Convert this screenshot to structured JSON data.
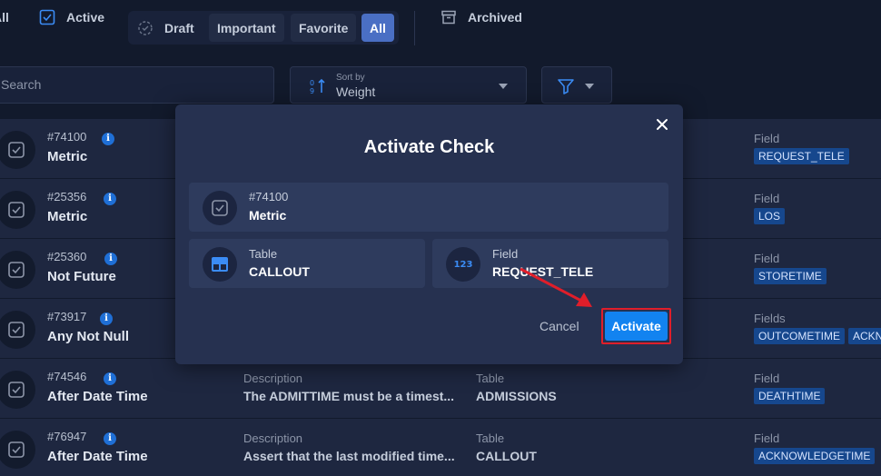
{
  "filters": {
    "all_partial": "All",
    "active": "Active",
    "draft": "Draft",
    "important": "Important",
    "favorite": "Favorite",
    "all": "All",
    "archived": "Archived"
  },
  "search": {
    "placeholder": "Search"
  },
  "sort": {
    "label": "Sort by",
    "value": "Weight"
  },
  "rows": [
    {
      "id": "#74100",
      "name": "Metric",
      "field_label": "Field",
      "tags": [
        "REQUEST_TELE"
      ]
    },
    {
      "id": "#25356",
      "name": "Metric",
      "field_label": "Field",
      "tags": [
        "LOS"
      ]
    },
    {
      "id": "#25360",
      "name": "Not Future",
      "field_label": "Field",
      "tags": [
        "STORETIME"
      ]
    },
    {
      "id": "#73917",
      "name": "Any Not Null",
      "field_label": "Fields",
      "tags": [
        "OUTCOMETIME",
        "ACKN"
      ]
    },
    {
      "id": "#74546",
      "name": "After Date Time",
      "desc_label": "Description",
      "desc": "The ADMITTIME must be a timest...",
      "table_label": "Table",
      "table": "ADMISSIONS",
      "field_label": "Field",
      "tags": [
        "DEATHTIME"
      ]
    },
    {
      "id": "#76947",
      "name": "After Date Time",
      "desc_label": "Description",
      "desc": "Assert that the last modified time...",
      "table_label": "Table",
      "table": "CALLOUT",
      "field_label": "Field",
      "tags": [
        "ACKNOWLEDGETIME"
      ]
    }
  ],
  "modal": {
    "title": "Activate Check",
    "check_id": "#74100",
    "check_name": "Metric",
    "table_label": "Table",
    "table_value": "CALLOUT",
    "field_label": "Field",
    "field_value": "REQUEST_TELE",
    "field_icon_text": "123",
    "cancel": "Cancel",
    "activate": "Activate"
  },
  "colors": {
    "background": "#121a2c",
    "row": "#1e2740",
    "modal": "#263150",
    "primary": "#1283f0",
    "tag": "#16478d",
    "highlight": "#e01e2a"
  }
}
